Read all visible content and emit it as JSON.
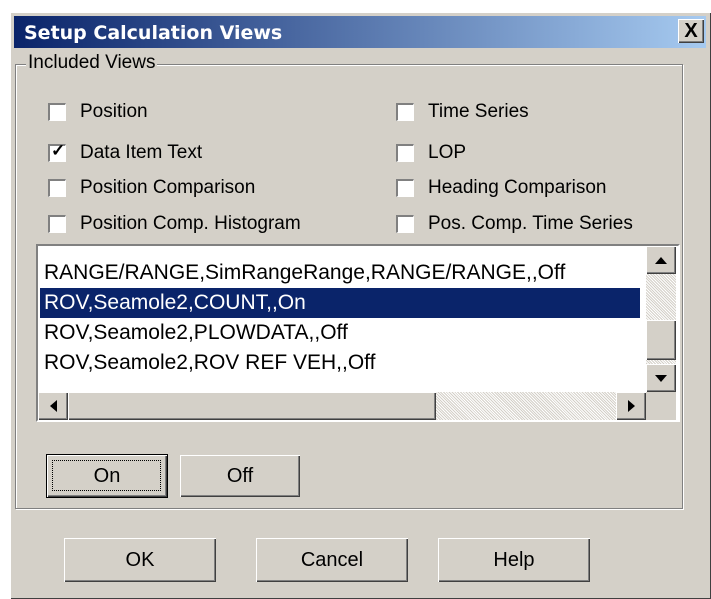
{
  "window": {
    "title": "Setup Calculation Views",
    "close_label": "X"
  },
  "included_views": {
    "legend": "Included Views",
    "checkboxes": [
      {
        "label": "Position",
        "checked": false
      },
      {
        "label": "Time Series",
        "checked": false
      },
      {
        "label": "Data Item Text",
        "checked": true
      },
      {
        "label": "LOP",
        "checked": false
      },
      {
        "label": "Position Comparison",
        "checked": false
      },
      {
        "label": "Heading Comparison",
        "checked": false
      },
      {
        "label": "Position Comp. Histogram",
        "checked": false
      },
      {
        "label": "Pos. Comp. Time Series",
        "checked": false
      }
    ],
    "list": {
      "items": [
        "RANGE/RANGE,SimRangeRange,RANGE/RANGE,,Off",
        "ROV,Seamole2,COUNT,,On",
        "ROV,Seamole2,PLOWDATA,,Off",
        "ROV,Seamole2,ROV REF VEH,,Off"
      ],
      "selected_index": 1
    },
    "on_label": "On",
    "off_label": "Off"
  },
  "footer": {
    "ok_label": "OK",
    "cancel_label": "Cancel",
    "help_label": "Help"
  },
  "colors": {
    "title_start": "#0a246a",
    "title_end": "#a6caf0",
    "face": "#d4d0c8",
    "selection": "#0a246a"
  }
}
